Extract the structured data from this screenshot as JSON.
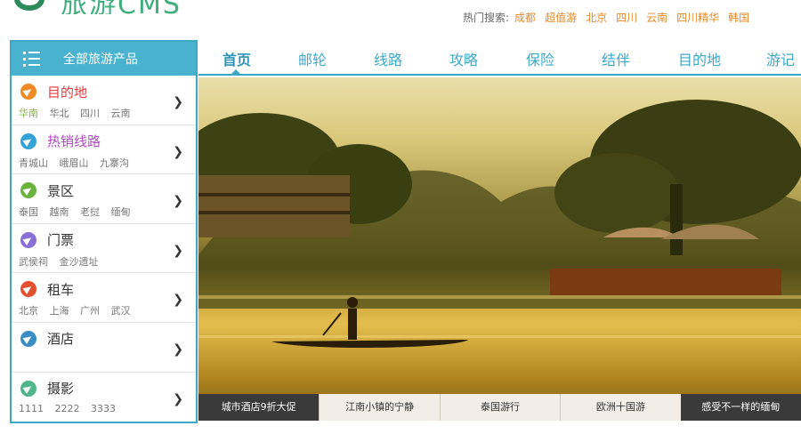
{
  "logo": {
    "text": "旅游CMS"
  },
  "hot_search": {
    "label": "热门搜索:",
    "links": [
      "成都",
      "超值游",
      "北京",
      "四川",
      "云南",
      "四川精华",
      "韩国"
    ]
  },
  "sidebar": {
    "title": "全部旅游产品",
    "categories": [
      {
        "name": "目的地",
        "name_color": "#e03a3a",
        "icon_color": "#f08a24",
        "icon": "paper-plane-icon",
        "subs": [
          "华南",
          "华北",
          "四川",
          "云南"
        ]
      },
      {
        "name": "热销线路",
        "name_color": "#b04ac0",
        "icon_color": "#34a3d8",
        "icon": "paper-plane-icon",
        "subs": [
          "青城山",
          "峨眉山",
          "九寨沟"
        ]
      },
      {
        "name": "景区",
        "name_color": "#333333",
        "icon_color": "#6ab43e",
        "icon": "paper-plane-icon",
        "subs": [
          "泰国",
          "越南",
          "老挝",
          "缅甸"
        ]
      },
      {
        "name": "门票",
        "name_color": "#333333",
        "icon_color": "#8a6fd6",
        "icon": "paper-plane-icon",
        "subs": [
          "武侯祠",
          "金沙遗址"
        ]
      },
      {
        "name": "租车",
        "name_color": "#333333",
        "icon_color": "#e3502f",
        "icon": "paper-plane-icon",
        "subs": [
          "北京",
          "上海",
          "广州",
          "武汉"
        ]
      },
      {
        "name": "酒店",
        "name_color": "#333333",
        "icon_color": "#3a8cc4",
        "icon": "paper-plane-icon",
        "subs": []
      },
      {
        "name": "摄影",
        "name_color": "#333333",
        "icon_color": "#4fb58d",
        "icon": "paper-plane-icon",
        "subs": [
          "1111",
          "2222",
          "3333"
        ]
      }
    ]
  },
  "nav": {
    "items": [
      "首页",
      "邮轮",
      "线路",
      "攻略",
      "保险",
      "结伴",
      "目的地",
      "游记"
    ],
    "active": "首页"
  },
  "banner": {
    "tabs": [
      "城市酒店9折大促",
      "江南小镇的宁静",
      "泰国游行",
      "欧洲十国游",
      "感受不一样的缅甸"
    ]
  },
  "colors": {
    "accent": "#3ca8c8",
    "hot_link": "#e28a2b",
    "sub_highlight": "#86b34a"
  }
}
